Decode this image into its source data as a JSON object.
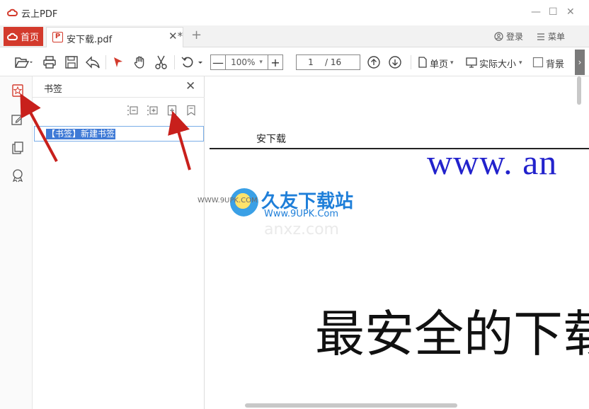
{
  "app": {
    "title": "云上PDF"
  },
  "window": {
    "minimize": "—",
    "maximize": "☐",
    "close": "✕"
  },
  "tabs": {
    "home_label": "首页",
    "doc_label": "安下载.pdf",
    "doc_close": "✕*",
    "new_tab": "+"
  },
  "account": {
    "login_label": "登录",
    "menu_label": "菜单"
  },
  "toolbar": {
    "zoom_minus": "—",
    "zoom_value": "100%",
    "zoom_caret": "▾",
    "zoom_plus": "+",
    "page_current": "1",
    "page_total": "/ 16",
    "single_page_label": "单页",
    "actual_size_label": "实际大小",
    "background_label": "背景",
    "more": "›"
  },
  "bookmark_panel": {
    "title": "书签",
    "close": "✕",
    "items": [
      {
        "label": "【书签】新建书签",
        "selected": true
      }
    ]
  },
  "document": {
    "header_text": "安下载",
    "url_text": "www. an",
    "big_text": "最安全的下载"
  },
  "watermark": {
    "brand": "久友下载站",
    "url": "Www.9UPK.Com",
    "small": "WWW.9UPK.COM",
    "faint": "anxz.com"
  },
  "colors": {
    "accent": "#d33a2c",
    "selection": "#3f7ad6",
    "link_blue": "#2222cc",
    "annotation_arrow": "#c8201c"
  }
}
